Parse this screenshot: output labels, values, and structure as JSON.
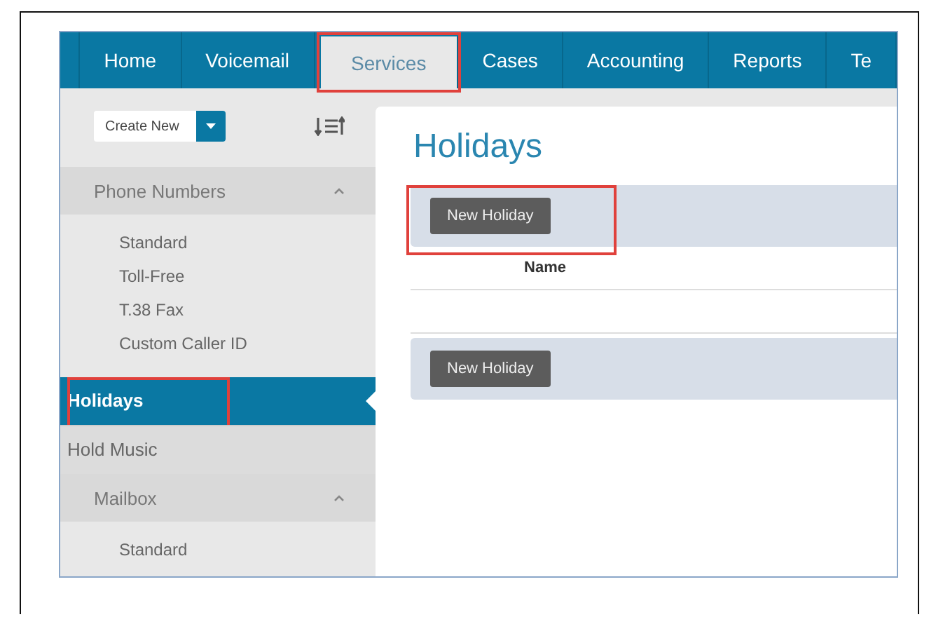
{
  "nav": {
    "tabs": [
      {
        "label": "Home",
        "selected": false,
        "highlighted": false
      },
      {
        "label": "Voicemail",
        "selected": false,
        "highlighted": false
      },
      {
        "label": "Services",
        "selected": true,
        "highlighted": true
      },
      {
        "label": "Cases",
        "selected": false,
        "highlighted": false
      },
      {
        "label": "Accounting",
        "selected": false,
        "highlighted": false
      },
      {
        "label": "Reports",
        "selected": false,
        "highlighted": false
      },
      {
        "label": "Te",
        "selected": false,
        "highlighted": false
      }
    ]
  },
  "sidebar": {
    "create_button": {
      "label": "Create New"
    },
    "sections": [
      {
        "kind": "group",
        "label": "Phone Numbers",
        "expanded": true,
        "children": [
          {
            "label": "Standard"
          },
          {
            "label": "Toll-Free"
          },
          {
            "label": "T.38 Fax"
          },
          {
            "label": "Custom Caller ID"
          }
        ]
      },
      {
        "kind": "page",
        "label": "Holidays",
        "selected": true,
        "highlighted": true
      },
      {
        "kind": "page",
        "label": "Hold Music",
        "selected": false,
        "highlighted": false
      },
      {
        "kind": "group",
        "label": "Mailbox",
        "expanded": true,
        "children": [
          {
            "label": "Standard"
          }
        ]
      }
    ]
  },
  "content": {
    "title": "Holidays",
    "top_toolbar": {
      "button": "New Holiday",
      "highlighted": true
    },
    "table": {
      "columns": [
        "Name"
      ]
    },
    "bottom_toolbar": {
      "button": "New Holiday",
      "highlighted": false
    }
  }
}
